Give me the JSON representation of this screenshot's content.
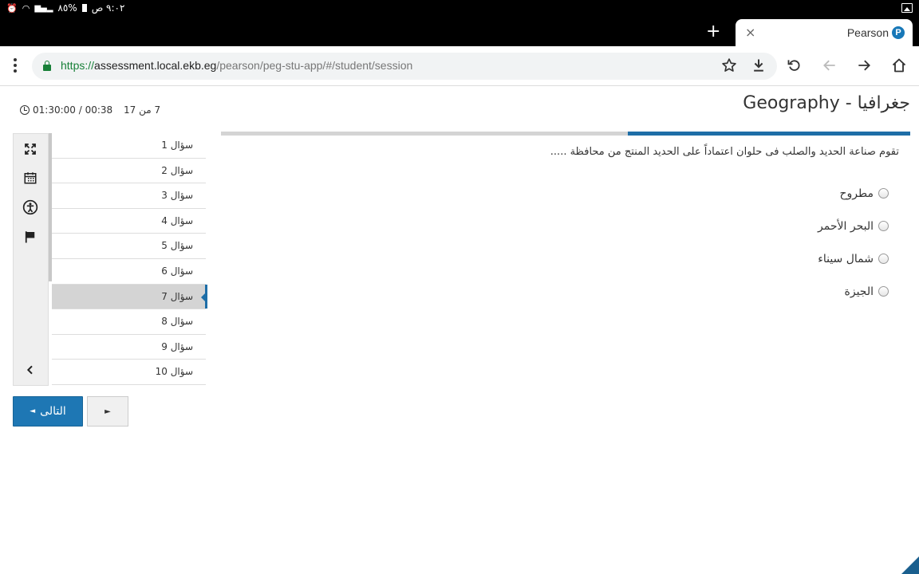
{
  "status_bar": {
    "time": "٩:٠٢ ص",
    "battery": "%٨٥"
  },
  "browser": {
    "new_tab": "+",
    "tab": {
      "title": "Pearson",
      "close": "×",
      "favicon": "P"
    },
    "url": {
      "scheme": "https://",
      "host": "assessment.local.ekb.eg",
      "path": "/pearson/peg-stu-app/#/student/session"
    },
    "icons": [
      "star-icon",
      "download-icon",
      "reload-icon",
      "back-icon",
      "forward-icon",
      "home-icon"
    ]
  },
  "header": {
    "title": "Geography - جغرافيا",
    "timer": "01:30:00 / 00:38",
    "progress_text": "7 من 17",
    "progress_fraction": 0.41
  },
  "question": {
    "text": "تقوم صناعة الحديد والصلب فى حلوان اعتماداً على الحديد المنتج من محافظة .....",
    "options": [
      "مطروح",
      "البحر الأحمر",
      "شمال سيناء",
      "الجيزة"
    ]
  },
  "tools": [
    "fullscreen-icon",
    "calendar-icon",
    "accessibility-icon",
    "flag-icon",
    "collapse-icon"
  ],
  "question_list": {
    "items": [
      "سؤال 1",
      "سؤال 2",
      "سؤال 3",
      "سؤال 4",
      "سؤال 5",
      "سؤال 6",
      "سؤال 7",
      "سؤال 8",
      "سؤال 9",
      "سؤال 10"
    ],
    "active_index": 6
  },
  "buttons": {
    "next": "التالى",
    "next_arrow": "◄",
    "prev_arrow": "►"
  }
}
